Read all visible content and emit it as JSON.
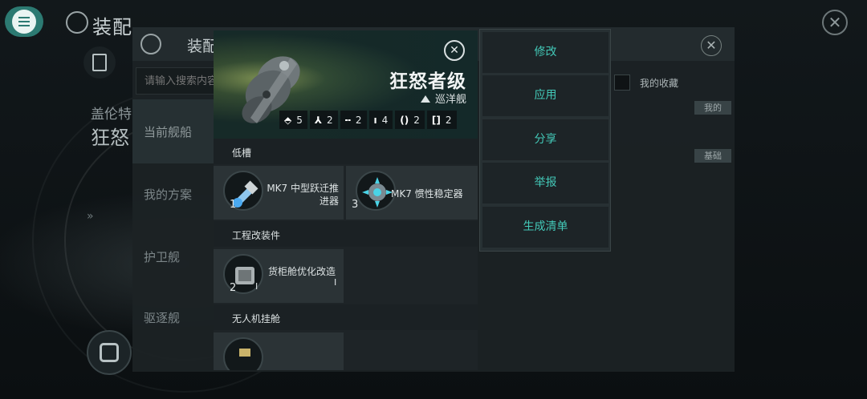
{
  "background": {
    "title": "装配",
    "subtitle": "盖伦特",
    "ship_name": "狂怒",
    "chevrons": "»",
    "close": "✕"
  },
  "fitting_dialog": {
    "title": "装配",
    "search_placeholder": "请输入搜索内容",
    "favorites_label": "我的收藏",
    "categories": [
      "当前舰船",
      "我的方案",
      "护卫舰",
      "驱逐舰"
    ],
    "tags": [
      "我的",
      "基础"
    ],
    "close": "✕"
  },
  "ship": {
    "name": "狂怒者级",
    "class": "巡洋舰",
    "close": "✕",
    "stats": [
      {
        "icon": "high-slot-icon",
        "glyph": "⬘",
        "value": "5"
      },
      {
        "icon": "turret-icon",
        "glyph": "⅄",
        "value": "2"
      },
      {
        "icon": "launcher-icon",
        "glyph": "╍",
        "value": "2"
      },
      {
        "icon": "medium-slot-icon",
        "glyph": "ı",
        "value": "4"
      },
      {
        "icon": "low-slot-icon",
        "glyph": "()",
        "value": "2"
      },
      {
        "icon": "rig-slot-icon",
        "glyph": "[]",
        "value": "2"
      }
    ],
    "sections": {
      "low_slot": "低槽",
      "rigs": "工程改装件",
      "drone_bay": "无人机挂舱"
    },
    "modules": {
      "mod1": {
        "name_line1": "MK7 中型跃迁推",
        "name_line2": "进器",
        "count": "1"
      },
      "mod2": {
        "name": "MK7 惯性稳定器",
        "count": "3"
      },
      "mod3": {
        "name": "货柜舱优化改造",
        "level": "I",
        "count": "2",
        "badge": "I"
      }
    }
  },
  "menu": {
    "items": [
      "修改",
      "应用",
      "分享",
      "举报",
      "生成清单"
    ]
  },
  "colors": {
    "accent": "#43c9b8",
    "menu_teal": "#2c7a72"
  }
}
